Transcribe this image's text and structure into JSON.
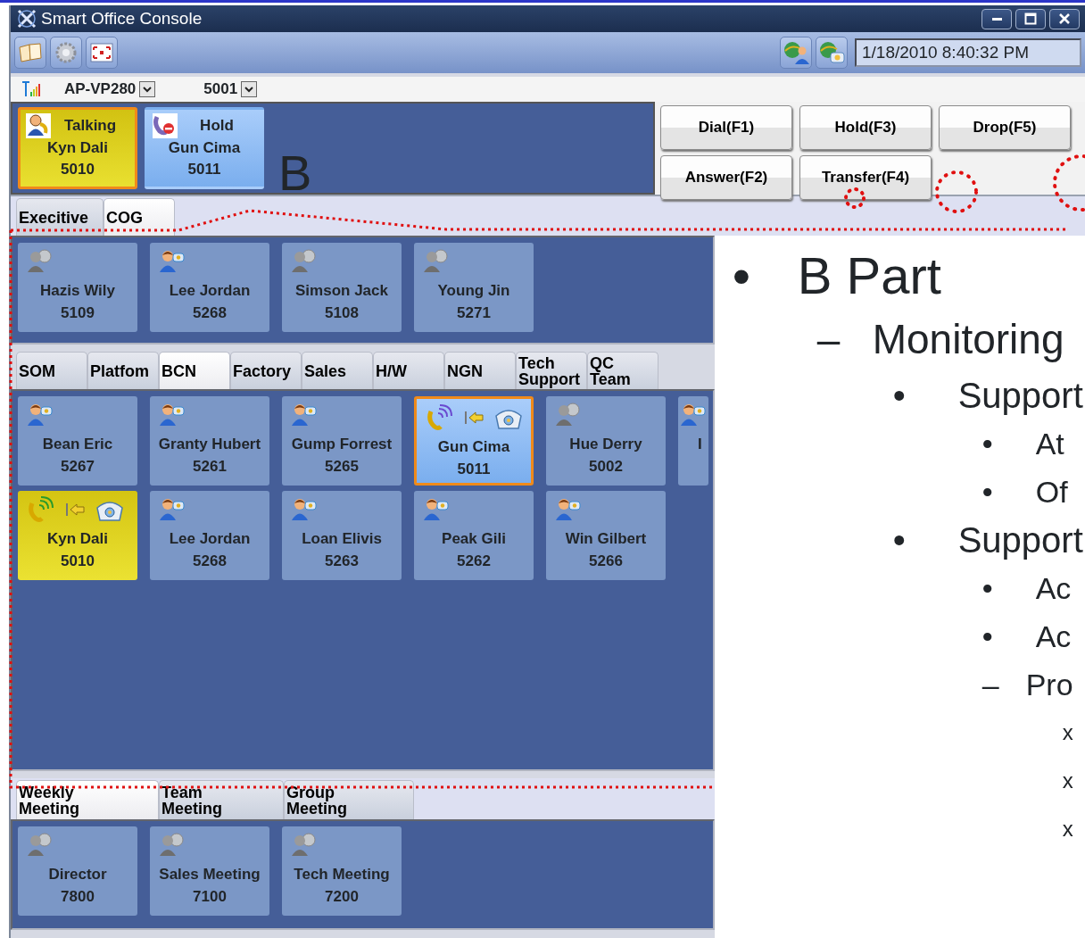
{
  "window": {
    "title": "Smart Office Console"
  },
  "toolbar": {
    "datetime": "1/18/2010 8:40:32 PM"
  },
  "line_bar": {
    "device": "AP-VP280",
    "extension": "5001"
  },
  "active_calls": [
    {
      "status": "Talking",
      "name": "Kyn Dali",
      "number": "5010",
      "kind": "talking"
    },
    {
      "status": "Hold",
      "name": "Gun Cima",
      "number": "5011",
      "kind": "hold"
    }
  ],
  "call_buttons": [
    "Dial(F1)",
    "Hold(F3)",
    "Drop(F5)",
    "Answer(F2)",
    "Transfer(F4)"
  ],
  "groups": [
    {
      "tabs": [
        {
          "label": "Execitive",
          "selected": false
        },
        {
          "label": "COG",
          "selected": true
        }
      ],
      "contacts": [
        {
          "name": "Hazis Wily",
          "number": "5109",
          "kind": "offline"
        },
        {
          "name": "Lee Jordan",
          "number": "5268",
          "kind": "available"
        },
        {
          "name": "Simson Jack",
          "number": "5108",
          "kind": "offline"
        },
        {
          "name": "Young Jin",
          "number": "5271",
          "kind": "offline"
        }
      ]
    },
    {
      "tabs": [
        {
          "label": "SOM",
          "selected": false
        },
        {
          "label": "Platfom",
          "selected": false
        },
        {
          "label": "BCN",
          "selected": true
        },
        {
          "label": "Factory",
          "selected": false
        },
        {
          "label": "Sales",
          "selected": false
        },
        {
          "label": "H/W",
          "selected": false
        },
        {
          "label": "NGN",
          "selected": false
        },
        {
          "label": "Tech Support",
          "selected": false
        },
        {
          "label": "QC Team",
          "selected": false
        }
      ],
      "contacts": [
        {
          "name": "Bean Eric",
          "number": "5267",
          "kind": "available"
        },
        {
          "name": "Granty Hubert",
          "number": "5261",
          "kind": "available"
        },
        {
          "name": "Gump Forrest",
          "number": "5265",
          "kind": "available"
        },
        {
          "name": "Gun Cima",
          "number": "5011",
          "kind": "hold"
        },
        {
          "name": "Hue Derry",
          "number": "5002",
          "kind": "offline"
        },
        {
          "name": "I",
          "kind": "available",
          "cut_off": true
        },
        {
          "name": "Kyn Dali",
          "number": "5010",
          "kind": "talking"
        },
        {
          "name": "Lee Jordan",
          "number": "5268",
          "kind": "available"
        },
        {
          "name": "Loan Elivis",
          "number": "5263",
          "kind": "available"
        },
        {
          "name": "Peak Gili",
          "number": "5262",
          "kind": "available"
        },
        {
          "name": "Win Gilbert",
          "number": "5266",
          "kind": "available"
        }
      ]
    },
    {
      "tabs": [
        {
          "label": "Weekly Meeting",
          "selected": true
        },
        {
          "label": "Team Meeting",
          "selected": false
        },
        {
          "label": "Group Meeting",
          "selected": false
        }
      ],
      "contacts": [
        {
          "name": "Director",
          "number": "7800",
          "kind": "offline"
        },
        {
          "name": "Sales Meeting",
          "number": "7100",
          "kind": "offline"
        },
        {
          "name": "Tech Meeting",
          "number": "7200",
          "kind": "offline"
        }
      ]
    }
  ],
  "slide": {
    "label": "B",
    "outline": [
      {
        "marker": "•",
        "text": "B Part",
        "kind": "bullet",
        "children": [
          {
            "marker": "–",
            "text": "Monitoring",
            "kind": "dash",
            "children": [
              {
                "marker": "•",
                "text": "Support",
                "kind": "bullet",
                "children": [
                  {
                    "marker": "•",
                    "text": "At",
                    "kind": "bullet"
                  },
                  {
                    "marker": "•",
                    "text": "Of",
                    "kind": "bullet"
                  }
                ]
              },
              {
                "marker": "•",
                "text": "Support",
                "kind": "bullet",
                "children": [
                  {
                    "marker": "•",
                    "text": "Ac",
                    "kind": "bullet"
                  },
                  {
                    "marker": "•",
                    "text": "Ac",
                    "kind": "bullet"
                  },
                  {
                    "marker": "–",
                    "text": "Pro",
                    "kind": "dash",
                    "children": [
                      {
                        "marker": "x",
                        "kind": "cross"
                      },
                      {
                        "marker": "x",
                        "kind": "cross"
                      },
                      {
                        "marker": "x",
                        "kind": "cross"
                      }
                    ]
                  }
                ]
              }
            ]
          }
        ]
      }
    ]
  }
}
